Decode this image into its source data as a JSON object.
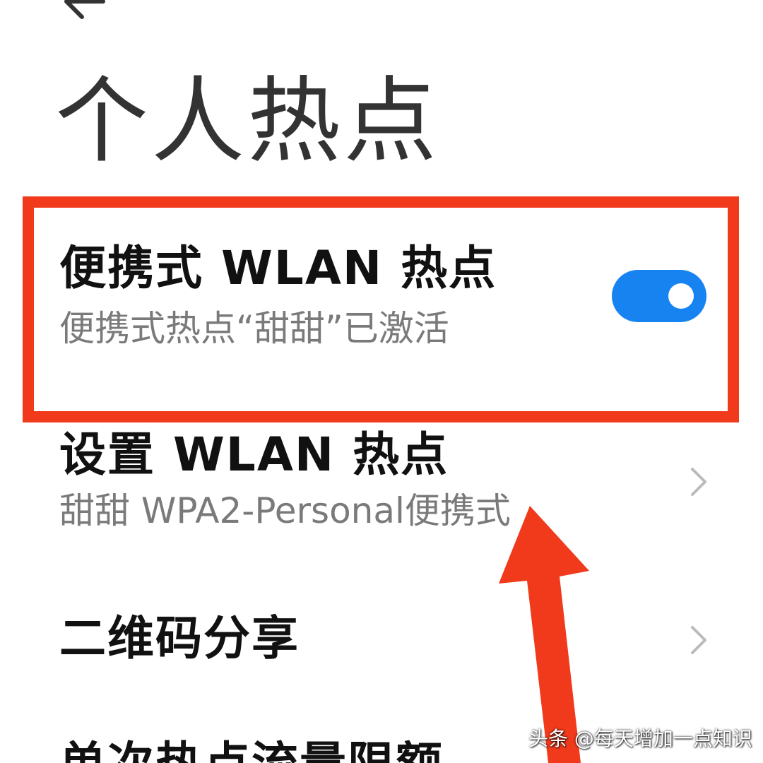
{
  "header": {
    "back_icon": "arrow-left-icon",
    "title": "个人热点"
  },
  "settings": {
    "portable_hotspot": {
      "title": "便携式 WLAN 热点",
      "subtitle": "便携式热点“甜甜”已激活",
      "toggle_on": true,
      "toggle_color": "#1683f0"
    },
    "setup_hotspot": {
      "title": "设置 WLAN 热点",
      "subtitle": "甜甜 WPA2-Personal便携式",
      "chevron_icon": "chevron-right-icon"
    },
    "qr_share": {
      "title": "二维码分享",
      "chevron_icon": "chevron-right-icon"
    },
    "data_limit": {
      "title": "单次热点流量限额"
    }
  },
  "annotations": {
    "highlight_color": "#f13a1c"
  },
  "watermark": {
    "text": "头条 @每天增加一点知识"
  }
}
